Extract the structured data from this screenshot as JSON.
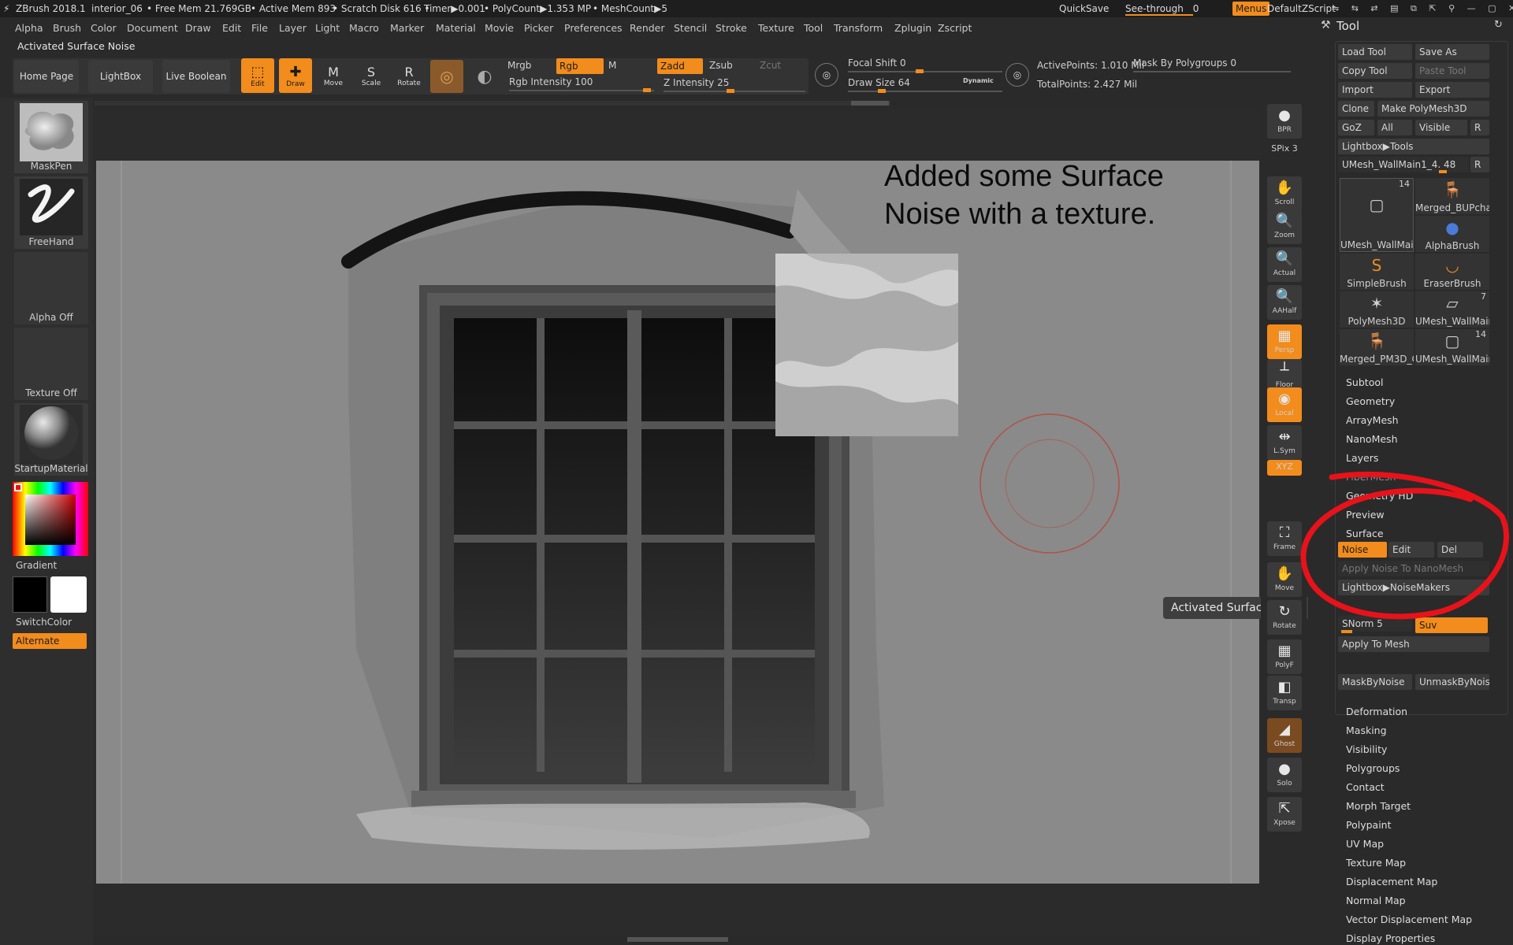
{
  "title_bar": {
    "app": "ZBrush 2018.1",
    "project": "interior_06",
    "free_mem": "• Free Mem 21.769GB",
    "active_mem": "• Active Mem 893",
    "scratch": "• Scratch Disk 616 •",
    "timer": "Timer▶0.001",
    "polycount": "• PolyCount▶1.353 MP",
    "meshcount": "• MeshCount▶5",
    "quicksave": "QuickSave",
    "seethrough": "See-through",
    "seethrough_val": "0",
    "menus": "Menus",
    "script": "DefaultZScript"
  },
  "menu_items": [
    "Alpha",
    "Brush",
    "Color",
    "Document",
    "Draw",
    "Edit",
    "File",
    "Layer",
    "Light",
    "Macro",
    "Marker",
    "Material",
    "Movie",
    "Picker",
    "Preferences",
    "Render",
    "Stencil",
    "Stroke",
    "Texture",
    "Tool",
    "Transform",
    "Zplugin",
    "Zscript"
  ],
  "notice": "Activated Surface Noise",
  "top_shelf": {
    "home": "Home Page",
    "lightbox": "LightBox",
    "live_boolean": "Live Boolean",
    "edit": "Edit",
    "draw": "Draw",
    "move": "Move",
    "scale": "Scale",
    "rotate": "Rotate",
    "mrgb": "Mrgb",
    "rgb": "Rgb",
    "m": "M",
    "zadd": "Zadd",
    "zsub": "Zsub",
    "zcut": "Zcut",
    "rgb_intensity": "Rgb Intensity 100",
    "z_intensity": "Z Intensity 25",
    "focal_shift": "Focal Shift 0",
    "draw_size": "Draw Size 64",
    "dynamic": "Dynamic",
    "active_points": "ActivePoints: 1.010 Mil",
    "total_points": "TotalPoints: 2.427 Mil",
    "mask_by_polygroups": "Mask By Polygroups 0"
  },
  "left_shelf": {
    "brush": "MaskPen",
    "stroke": "FreeHand",
    "alpha": "Alpha Off",
    "texture": "Texture Off",
    "material": "StartupMaterial",
    "gradient": "Gradient",
    "switchcolor": "SwitchColor",
    "alternate": "Alternate"
  },
  "viewport": {
    "caption_line1": "Added some Surface",
    "caption_line2": "Noise with a texture.",
    "tooltip": "Activated Surface Noise"
  },
  "right_shelf": [
    {
      "label": "BPR",
      "icon": "●"
    },
    {
      "label": "SPix 3",
      "icon": ""
    },
    {
      "label": "Scroll",
      "icon": "✋"
    },
    {
      "label": "Zoom",
      "icon": "🔍"
    },
    {
      "label": "Actual",
      "icon": "🔍"
    },
    {
      "label": "AAHalf",
      "icon": "🔍"
    },
    {
      "label": "Persp",
      "icon": "▦"
    },
    {
      "label": "Floor",
      "icon": "┴"
    },
    {
      "label": "Local",
      "icon": "◉"
    },
    {
      "label": "L.Sym",
      "icon": "⇹"
    },
    {
      "label": "XYZ",
      "icon": ""
    },
    {
      "label": "Frame",
      "icon": "⛶"
    },
    {
      "label": "Move",
      "icon": "✋"
    },
    {
      "label": "Rotate",
      "icon": "↻"
    },
    {
      "label": "PolyF",
      "icon": "▦"
    },
    {
      "label": "Transp",
      "icon": "◧"
    },
    {
      "label": "Ghost",
      "icon": "◢"
    },
    {
      "label": "Solo",
      "icon": "●"
    },
    {
      "label": "Xpose",
      "icon": "⇱"
    }
  ],
  "tool_panel": {
    "title": "Tool",
    "load": "Load Tool",
    "save": "Save As",
    "copy": "Copy Tool",
    "paste": "Paste Tool",
    "import": "Import",
    "export": "Export",
    "clone": "Clone",
    "make_polymesh": "Make PolyMesh3D",
    "goz": "GoZ",
    "all": "All",
    "visible": "Visible",
    "r": "R",
    "lightbox_tools": "Lightbox▶Tools",
    "current_tool": "UMesh_WallMain1_4. 48",
    "thumbs": [
      {
        "label": "UMesh_WallMain",
        "count": "14",
        "icon": "▢"
      },
      {
        "label": "Merged_BUPcha",
        "count": "",
        "icon": "🪑"
      },
      {
        "label": "AlphaBrush",
        "count": "",
        "icon": "●"
      },
      {
        "label": "SimpleBrush",
        "count": "",
        "icon": "S"
      },
      {
        "label": "EraserBrush",
        "count": "",
        "icon": "◡"
      },
      {
        "label": "PolyMesh3D",
        "count": "",
        "icon": "✶"
      },
      {
        "label": "UMesh_WallMain",
        "count": "7",
        "icon": "▱"
      },
      {
        "label": "Merged_PM3D_C",
        "count": "",
        "icon": "🪑"
      },
      {
        "label": "UMesh_WallMain",
        "count": "14",
        "icon": "▢"
      }
    ],
    "sections_top": [
      "Subtool",
      "Geometry",
      "ArrayMesh",
      "NanoMesh",
      "Layers"
    ],
    "fibermesh": "FiberMesh",
    "geometry_hd": "Geometry HD",
    "preview": "Preview",
    "surface": "Surface",
    "noise": "Noise",
    "edit": "Edit",
    "del": "Del",
    "apply_nanomesh": "Apply Noise To NanoMesh",
    "lightbox_noisemakers": "Lightbox▶NoiseMakers",
    "snorm": "SNorm 5",
    "suv": "Suv",
    "apply_mesh": "Apply To Mesh",
    "mask_by_noise": "MaskByNoise",
    "unmask_by_noise": "UnmaskByNoise",
    "sections_bottom": [
      "Deformation",
      "Masking",
      "Visibility",
      "Polygroups",
      "Contact",
      "Morph Target",
      "Polypaint",
      "UV Map",
      "Texture Map",
      "Displacement Map",
      "Normal Map",
      "Vector Displacement Map",
      "Display Properties"
    ]
  },
  "colors": {
    "accent": "#f28c1c",
    "annotation": "#e8121a",
    "panel": "#2a2a2a",
    "viewport": "#878787"
  }
}
